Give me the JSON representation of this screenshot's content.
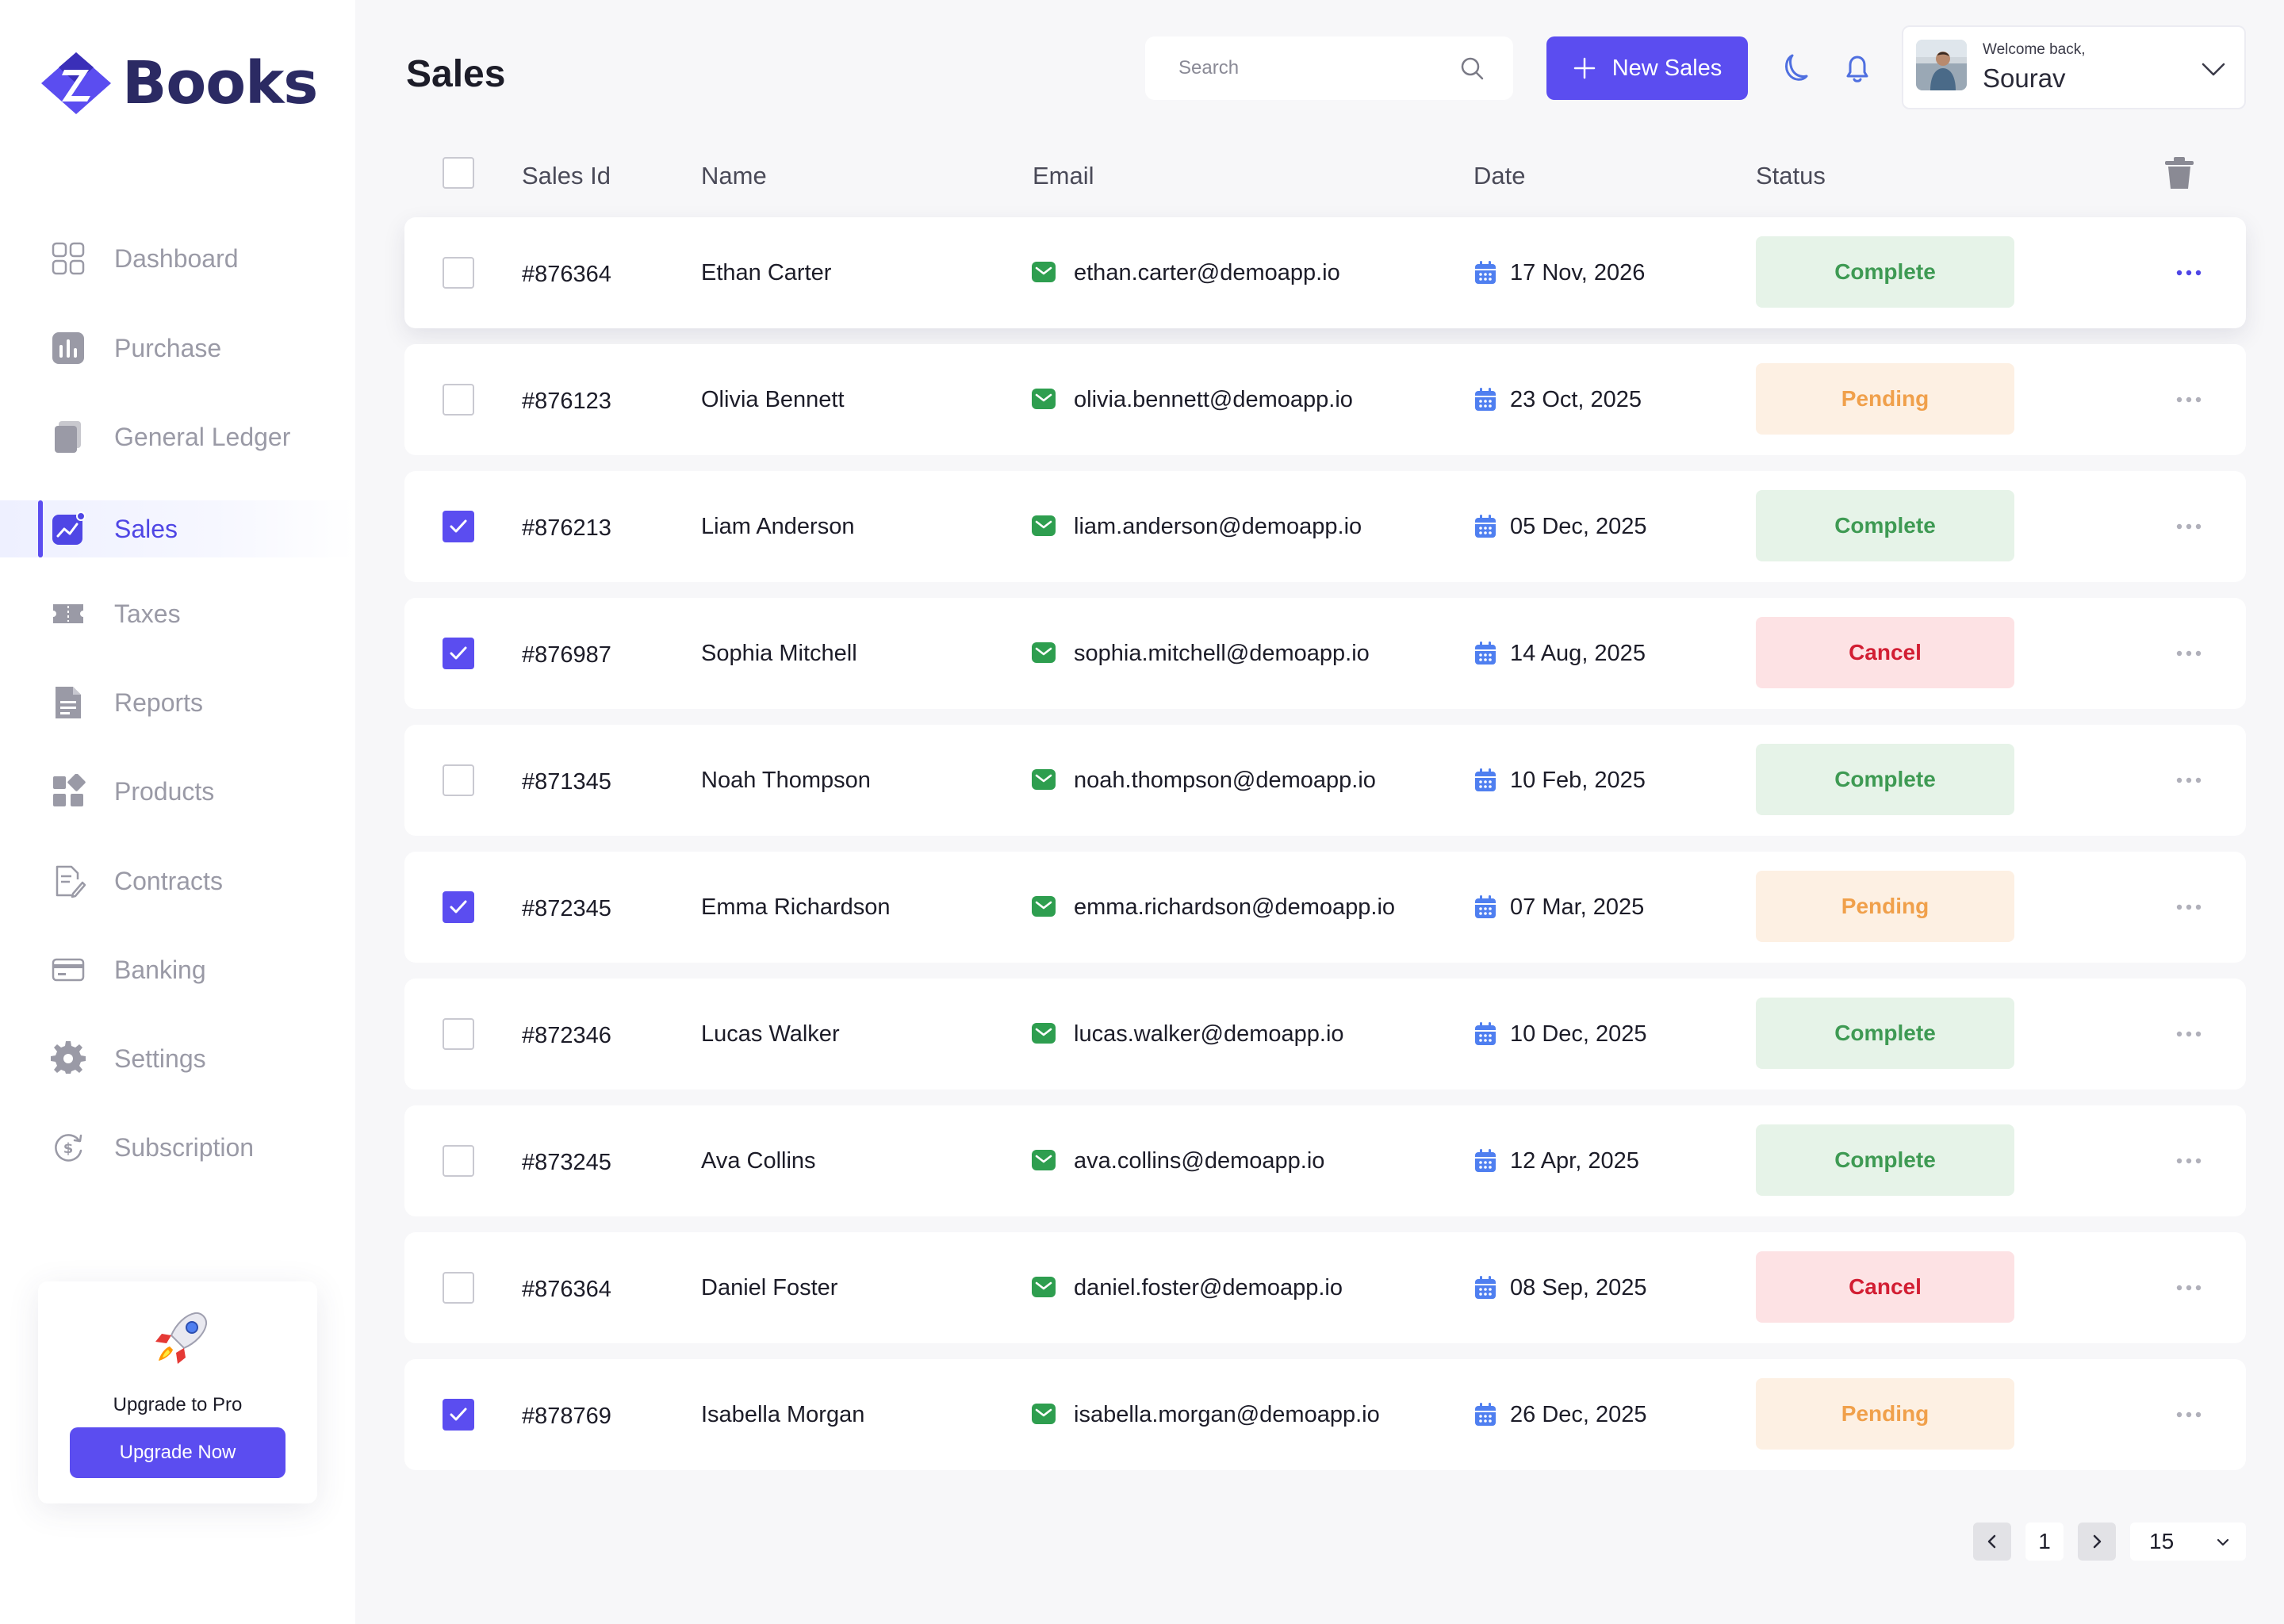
{
  "app": {
    "brand": "Books",
    "brand_color": "#5b4df0"
  },
  "sidebar": {
    "items": [
      {
        "label": "Dashboard",
        "icon": "grid-icon",
        "active": false
      },
      {
        "label": "Purchase",
        "icon": "bar-chart-icon",
        "active": false
      },
      {
        "label": "General Ledger",
        "icon": "ledger-icon",
        "active": false
      },
      {
        "label": "Sales",
        "icon": "sales-chart-icon",
        "active": true
      },
      {
        "label": "Taxes",
        "icon": "ticket-icon",
        "active": false
      },
      {
        "label": "Reports",
        "icon": "report-icon",
        "active": false
      },
      {
        "label": "Products",
        "icon": "products-icon",
        "active": false
      },
      {
        "label": "Contracts",
        "icon": "contract-icon",
        "active": false
      },
      {
        "label": "Banking",
        "icon": "card-icon",
        "active": false
      },
      {
        "label": "Settings",
        "icon": "gear-icon",
        "active": false
      },
      {
        "label": "Subscription",
        "icon": "subscription-icon",
        "active": false
      }
    ],
    "upgrade": {
      "title": "Upgrade to Pro",
      "button": "Upgrade Now"
    }
  },
  "header": {
    "title": "Sales",
    "search_placeholder": "Search",
    "new_button": "New Sales",
    "welcome": "Welcome back,",
    "user_name": "Sourav"
  },
  "table": {
    "columns": [
      "Sales Id",
      "Name",
      "Email",
      "Date",
      "Status"
    ],
    "rows": [
      {
        "id": "#876364",
        "name": "Ethan Carter",
        "email": "ethan.carter@demoapp.io",
        "date": "17 Nov, 2026",
        "status": "Complete",
        "checked": false
      },
      {
        "id": "#876123",
        "name": "Olivia Bennett",
        "email": "olivia.bennett@demoapp.io",
        "date": "23 Oct, 2025",
        "status": "Pending",
        "checked": false
      },
      {
        "id": "#876213",
        "name": "Liam Anderson",
        "email": "liam.anderson@demoapp.io",
        "date": "05 Dec, 2025",
        "status": "Complete",
        "checked": true
      },
      {
        "id": "#876987",
        "name": "Sophia Mitchell",
        "email": "sophia.mitchell@demoapp.io",
        "date": "14 Aug, 2025",
        "status": "Cancel",
        "checked": true
      },
      {
        "id": "#871345",
        "name": "Noah Thompson",
        "email": "noah.thompson@demoapp.io",
        "date": "10 Feb, 2025",
        "status": "Complete",
        "checked": false
      },
      {
        "id": "#872345",
        "name": "Emma Richardson",
        "email": "emma.richardson@demoapp.io",
        "date": "07 Mar, 2025",
        "status": "Pending",
        "checked": true
      },
      {
        "id": "#872346",
        "name": "Lucas Walker",
        "email": "lucas.walker@demoapp.io",
        "date": "10 Dec, 2025",
        "status": "Complete",
        "checked": false
      },
      {
        "id": "#873245",
        "name": "Ava Collins",
        "email": "ava.collins@demoapp.io",
        "date": "12 Apr, 2025",
        "status": "Complete",
        "checked": false
      },
      {
        "id": "#876364",
        "name": "Daniel Foster",
        "email": "daniel.foster@demoapp.io",
        "date": "08 Sep, 2025",
        "status": "Cancel",
        "checked": false
      },
      {
        "id": "#878769",
        "name": "Isabella Morgan",
        "email": "isabella.morgan@demoapp.io",
        "date": "26 Dec, 2025",
        "status": "Pending",
        "checked": true
      }
    ]
  },
  "pagination": {
    "page": "1",
    "page_size": "15"
  },
  "colors": {
    "complete_bg": "#e6f3e8",
    "complete_text": "#3e9a53",
    "pending_bg": "#fdf0e3",
    "pending_text": "#f0a04b",
    "cancel_bg": "#fde2e4",
    "cancel_text": "#d21e33"
  }
}
